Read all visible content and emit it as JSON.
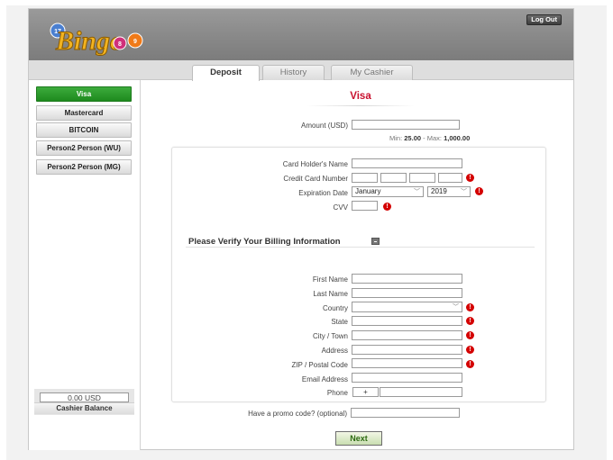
{
  "header": {
    "logout_label": "Log Out",
    "logo_text": "Bingo"
  },
  "tabs": [
    {
      "label": "Deposit",
      "active": true
    },
    {
      "label": "History",
      "active": false
    },
    {
      "label": "My Cashier",
      "active": false
    }
  ],
  "sidebar": {
    "methods": [
      {
        "label": "Visa",
        "active": true
      },
      {
        "label": "Mastercard",
        "active": false
      },
      {
        "label": "BITCOIN",
        "active": false
      },
      {
        "label": "Person2 Person (WU)",
        "active": false
      },
      {
        "label": "Person2 Person (MG)",
        "active": false
      }
    ],
    "balance": {
      "value": "0.00 USD",
      "label": "Cashier Balance"
    }
  },
  "main": {
    "title": "Visa",
    "amount": {
      "label": "Amount (USD)",
      "value": ""
    },
    "limits": {
      "min_label": "Min:",
      "min": "25.00",
      "sep": "- Max:",
      "max": "1,000.00"
    },
    "card": {
      "holder_label": "Card Holder's Name",
      "number_label": "Credit Card Number",
      "expiry_label": "Expiration Date",
      "expiry_month": "January",
      "expiry_year": "2019",
      "cvv_label": "CVV"
    },
    "billing": {
      "title": "Please Verify Your Billing Information",
      "first_name_label": "First Name",
      "last_name_label": "Last Name",
      "country_label": "Country",
      "state_label": "State",
      "city_label": "City / Town",
      "address_label": "Address",
      "zip_label": "ZIP / Postal Code",
      "email_label": "Email Address",
      "phone_label": "Phone",
      "phone_prefix": "+"
    },
    "promo_label": "Have a promo code? (optional)",
    "next_label": "Next"
  },
  "colors": {
    "accent_red": "#c8102e",
    "active_green": "#2a9a2a",
    "error_red": "#d40000"
  }
}
